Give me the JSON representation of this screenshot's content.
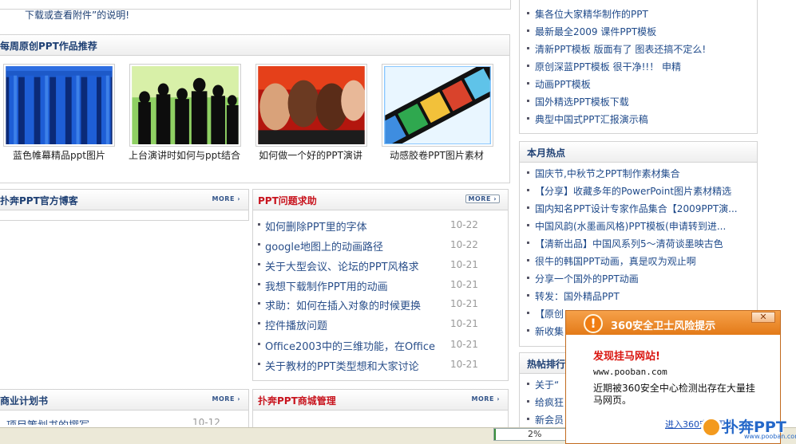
{
  "top_note": "下载或查看附件”的说明!",
  "weekly": {
    "title": "每周原创PPT作品推荐",
    "items": [
      {
        "caption": "蓝色帷幕精品ppt图片"
      },
      {
        "caption": "上台演讲时如何与ppt结合"
      },
      {
        "caption": "如何做一个好的PPT演讲"
      },
      {
        "caption": "动感胶卷PPT图片素材"
      }
    ]
  },
  "blog": {
    "title": "扑奔PPT官方博客",
    "more": "MORE ›"
  },
  "help": {
    "title": "PPT问题求助",
    "more": "MORE ›",
    "items": [
      {
        "q": "如何删除PPT里的字体",
        "date": "10-22"
      },
      {
        "q": "google地图上的动画路径",
        "date": "10-22"
      },
      {
        "q": "关于大型会议、论坛的PPT风格求",
        "date": "10-21"
      },
      {
        "q": "我想下载制作PPT用的动画",
        "date": "10-21"
      },
      {
        "q": "求助：如何在插入对象的时候更换",
        "date": "10-21"
      },
      {
        "q": "控件播放问题",
        "date": "10-21"
      },
      {
        "q": "Office2003中的三维功能，在Office",
        "date": "10-21"
      },
      {
        "q": "关于教材的PPT类型想和大家讨论",
        "date": "10-21"
      }
    ]
  },
  "business": {
    "title": "商业计划书",
    "more": "MORE ›",
    "first_item": "项目策划书的撰写",
    "first_date": "10-12"
  },
  "shop": {
    "title": "扑奔PPT商城管理",
    "more": "MORE ›"
  },
  "right_top": {
    "items": [
      "集各位大家精华制作的PPT",
      "最新最全2009 课件PPT模板",
      "清新PPT模板  版面有了  图表还搞不定么!",
      "原创深蓝PPT模板  很干净!!！  申精",
      "动画PPT模板",
      "国外精选PPT模板下载",
      "典型中国式PPT汇报演示稿"
    ]
  },
  "hot": {
    "title": "本月热点",
    "items": [
      "国庆节,中秋节之PPT制作素材集合",
      "【分享】收藏多年的PowerPoint图片素材精选",
      "国内知名PPT设计专家作品集合【2009PPT演...",
      "中国风韵(水墨画风格)PPT模板(申请转到进...",
      "【清新出品】中国风系列5～清荷谈墨映古色",
      "很牛的韩国PPT动画，真是叹为观止啊",
      "分享一个国外的PPT动画",
      "转发：国外精品PPT",
      "【原创",
      "新收集"
    ]
  },
  "hot_posts": {
    "title": "热帖排行",
    "items": [
      "关于“",
      "给疯狂",
      "新会员"
    ]
  },
  "popup": {
    "title": "360安全卫士风险提示",
    "close": "✕",
    "headline": "发现挂马网站!",
    "url": "www.pooban.com",
    "body": "近期被360安全中心检测出存在大量挂马网页。",
    "link": "进入360安全卫士"
  },
  "status": {
    "progress_text": "2%",
    "progress": 0.02
  },
  "watermark": {
    "brand": "扑奔PPT",
    "url": "www.pooban.com"
  }
}
